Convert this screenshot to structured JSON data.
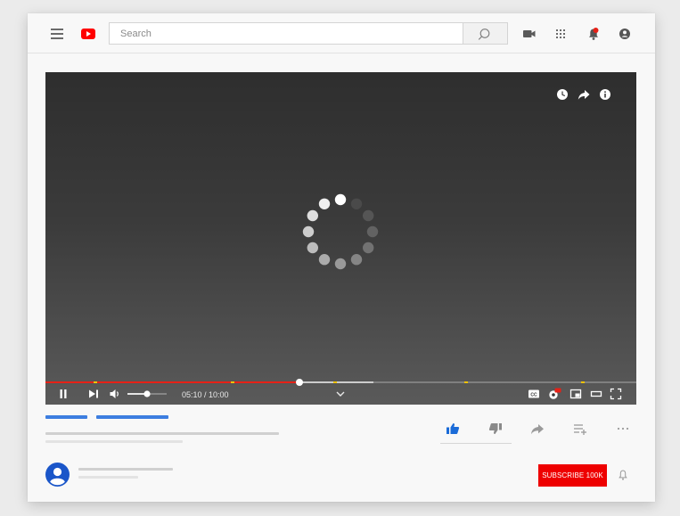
{
  "header": {
    "search": {
      "placeholder": "Search",
      "value": ""
    },
    "icons": [
      "menu-icon",
      "youtube-logo",
      "search-icon",
      "video-camera-icon",
      "apps-grid-icon",
      "notification-bell-icon",
      "account-icon"
    ],
    "brand_color": "#ff0000",
    "notification_dot_color": "#e62117"
  },
  "player": {
    "state": "loading",
    "top_icons": [
      "watch-later-icon",
      "share-icon",
      "info-icon"
    ],
    "time": {
      "display": "05:10 / 10:00",
      "played_fraction": 0.43,
      "buffered_fraction": 0.555
    },
    "volume_fraction": 0.5,
    "ad_marker_fractions": [
      0.082,
      0.314,
      0.487,
      0.709,
      0.907
    ],
    "bottom_right_icons": [
      "captions-icon",
      "settings-hd-icon",
      "miniplayer-icon",
      "theater-mode-icon",
      "fullscreen-icon"
    ],
    "progress_color": "#e62117"
  },
  "video_meta": {
    "actions": [
      "like-icon",
      "dislike-icon",
      "share-icon",
      "add-to-playlist-icon",
      "more-icon"
    ],
    "like_active": true
  },
  "channel": {
    "subscribe_label": "SUBSCRIBE 100K",
    "subscribe_color": "#ee0000"
  }
}
